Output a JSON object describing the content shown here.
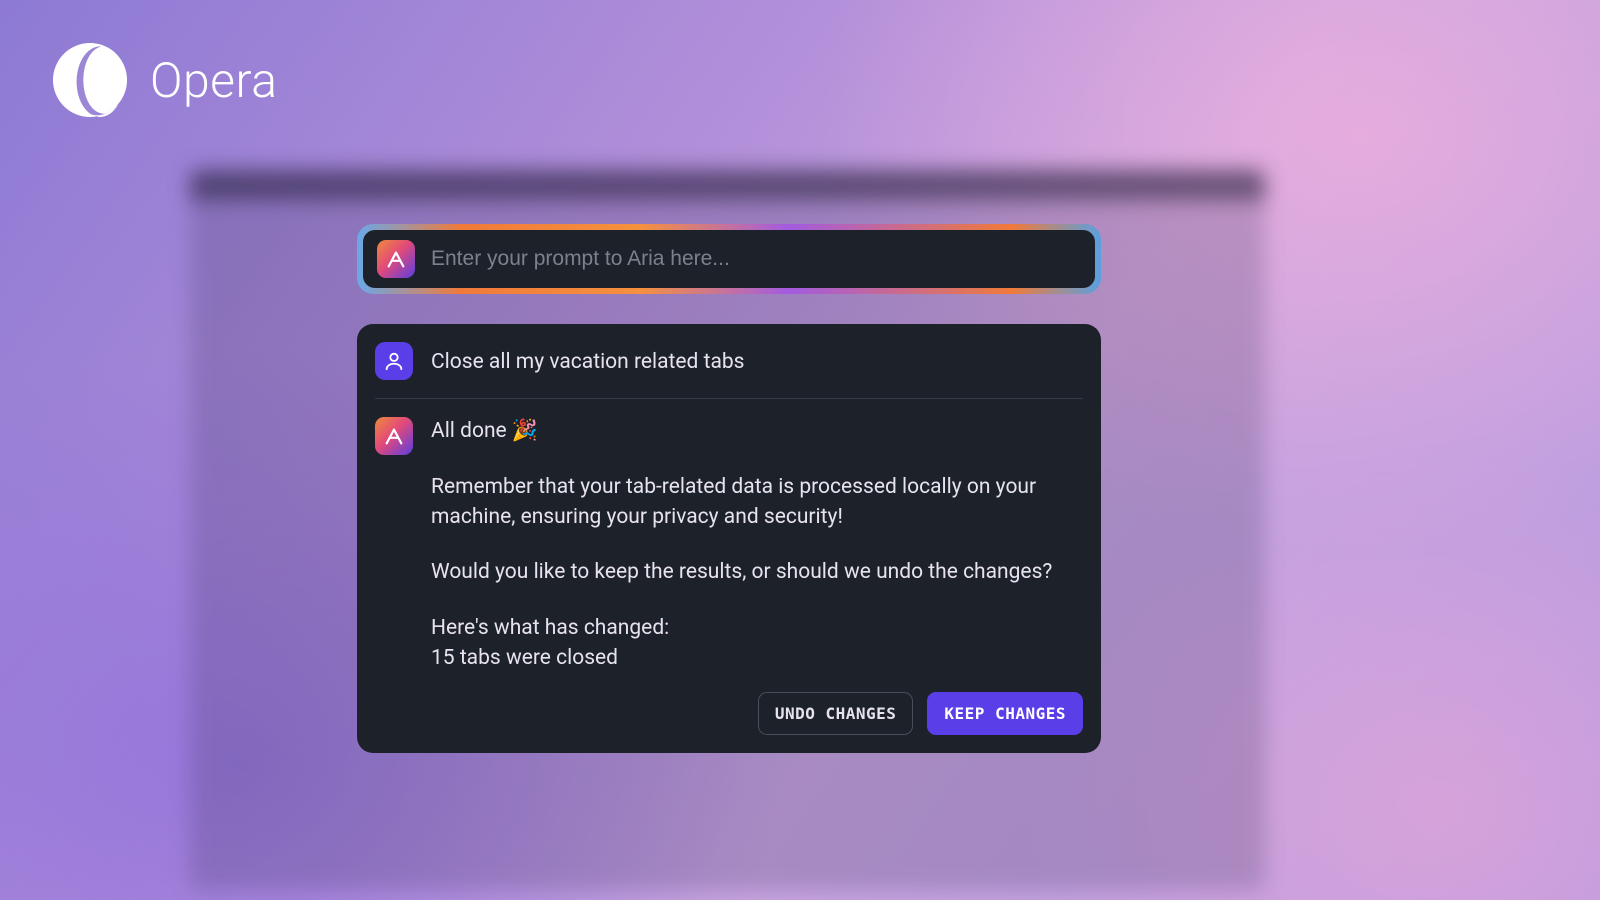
{
  "brand": {
    "name": "Opera"
  },
  "prompt": {
    "placeholder": "Enter your prompt to Aria here..."
  },
  "conversation": {
    "user_message": "Close all my vacation related tabs",
    "assistant": {
      "headline": "All done 🎉",
      "privacy_note": "Remember that your tab-related data is processed locally on your machine, ensuring your privacy and security!",
      "followup_question": "Would you like to keep the results, or should we undo the changes?",
      "changes_intro": "Here's what has changed:",
      "changes_summary": "15 tabs were closed"
    }
  },
  "actions": {
    "undo_label": "UNDO CHANGES",
    "keep_label": "KEEP CHANGES"
  }
}
